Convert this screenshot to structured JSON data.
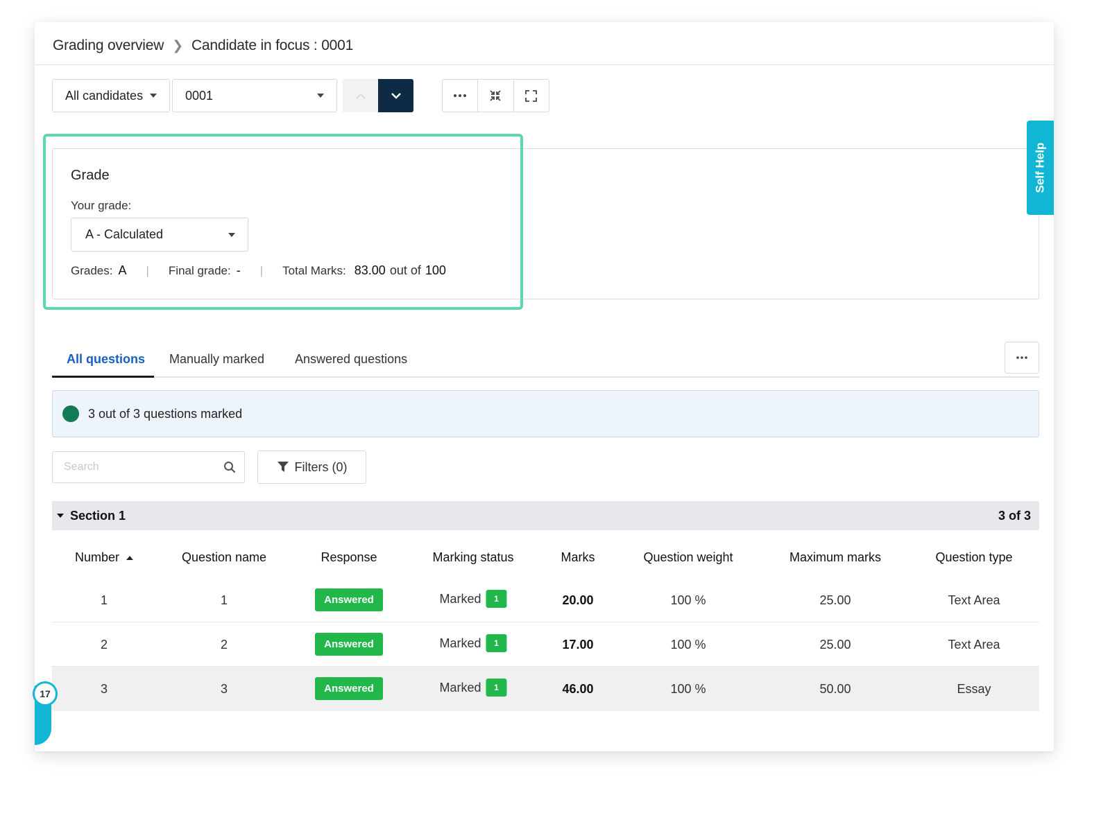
{
  "breadcrumb": {
    "root": "Grading overview",
    "current": "Candidate in focus : 0001"
  },
  "toolbar": {
    "candidates_filter": "All candidates",
    "candidate_id": "0001"
  },
  "grade_panel": {
    "title": "Grade",
    "your_grade_label": "Your grade:",
    "selected_grade": "A - Calculated",
    "grades_label": "Grades:",
    "grades_value": "A",
    "final_grade_label": "Final grade:",
    "final_grade_value": "-",
    "total_marks_label": "Total Marks:",
    "total_marks_value": "83.00",
    "total_marks_of": "out of",
    "total_marks_max": "100"
  },
  "self_help_label": "Self Help",
  "tabs": [
    {
      "label": "All questions",
      "active": true
    },
    {
      "label": "Manually marked",
      "active": false
    },
    {
      "label": "Answered questions",
      "active": false
    }
  ],
  "status": {
    "text": "3 out of 3 questions marked",
    "color": "#137a55"
  },
  "search": {
    "placeholder": "Search",
    "value": ""
  },
  "filters": {
    "label": "Filters (0)"
  },
  "section": {
    "name": "Section 1",
    "count": "3 of 3"
  },
  "table": {
    "columns": [
      "Number",
      "Question name",
      "Response",
      "Marking status",
      "Marks",
      "Question weight",
      "Maximum marks",
      "Question type"
    ],
    "rows": [
      {
        "number": "1",
        "name": "1",
        "response": "Answered",
        "status": "Marked",
        "status_count": "1",
        "marks": "20.00",
        "weight": "100 %",
        "max": "25.00",
        "type": "Text Area"
      },
      {
        "number": "2",
        "name": "2",
        "response": "Answered",
        "status": "Marked",
        "status_count": "1",
        "marks": "17.00",
        "weight": "100 %",
        "max": "25.00",
        "type": "Text Area"
      },
      {
        "number": "3",
        "name": "3",
        "response": "Answered",
        "status": "Marked",
        "status_count": "1",
        "marks": "46.00",
        "weight": "100 %",
        "max": "50.00",
        "type": "Essay"
      }
    ]
  },
  "widget_badge": "17",
  "colors": {
    "accent": "#1760bd",
    "success": "#21b74b",
    "highlight_border": "#5bdaa9",
    "help": "#11b6d4",
    "nav_dark": "#0e2a44"
  },
  "icons": [
    "chevron-right-icon",
    "caret-down-icon",
    "chevron-up-icon",
    "chevron-down-icon",
    "more-icon",
    "collapse-icon",
    "expand-icon",
    "search-icon",
    "filter-icon",
    "sort-asc-icon"
  ]
}
